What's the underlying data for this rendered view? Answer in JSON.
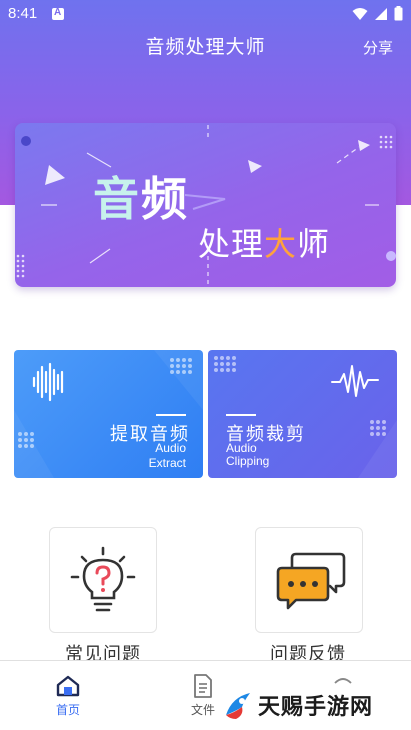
{
  "status_bar": {
    "time": "8:41"
  },
  "header": {
    "title": "音频处理大师",
    "share_label": "分享"
  },
  "banner": {
    "line1_a": "音",
    "line1_b": "频",
    "line2_a": "处理",
    "line2_b": "大",
    "line2_c": "师"
  },
  "cards": {
    "extract": {
      "title": "提取音频",
      "en_line1": "Audio",
      "en_line2": "Extract"
    },
    "clip": {
      "title": "音频裁剪",
      "en_line1": "Audio",
      "en_line2": "Clipping"
    }
  },
  "features": {
    "faq_label": "常见问题",
    "feedback_label": "问题反馈"
  },
  "bottom_nav": {
    "home_label": "首页",
    "files_label": "文件"
  },
  "watermark": {
    "text": "天赐手游网"
  },
  "colors": {
    "header_top": "#6f72ee",
    "header_bottom": "#a458e0",
    "card_blue": "#3b8af6",
    "card_indigo": "#6468eb",
    "active_nav": "#3a6ef2",
    "accent_orange": "#ffa23c"
  }
}
